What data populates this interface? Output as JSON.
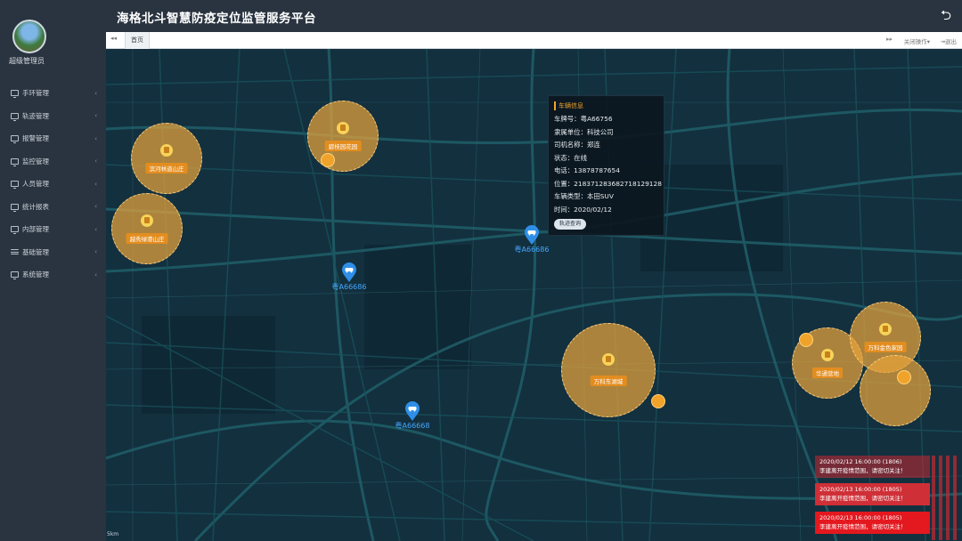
{
  "app": {
    "title": "海格北斗智慧防疫定位监管服务平台"
  },
  "user": {
    "name": "超级管理员"
  },
  "sidebar": {
    "items": [
      {
        "label": "手环管理",
        "icon": "monitor-icon"
      },
      {
        "label": "轨迹管理",
        "icon": "monitor-icon"
      },
      {
        "label": "报警管理",
        "icon": "monitor-icon"
      },
      {
        "label": "监控管理",
        "icon": "monitor-icon"
      },
      {
        "label": "人员管理",
        "icon": "monitor-icon"
      },
      {
        "label": "统计报表",
        "icon": "monitor-icon"
      },
      {
        "label": "内部管理",
        "icon": "monitor-icon"
      },
      {
        "label": "基础管理",
        "icon": "list-icon"
      },
      {
        "label": "系统管理",
        "icon": "monitor-icon"
      }
    ]
  },
  "tabs": {
    "prev": "◂◂",
    "home": "首页",
    "next": "▸▸",
    "close_ops": "关闭操作▾",
    "logout": "⇥退出"
  },
  "map": {
    "zones": [
      {
        "label": "滨河林道山庄"
      },
      {
        "label": "碧桂园花园"
      },
      {
        "label": "越秀绿港山庄"
      },
      {
        "label": "万科东湖城"
      },
      {
        "label": "华通营地"
      },
      {
        "label": "万科金色家园"
      }
    ],
    "vehicles": [
      {
        "plate": "粤A66686"
      },
      {
        "plate": "粤A66686"
      },
      {
        "plate": "粤A66668"
      }
    ],
    "scale": "5km"
  },
  "vehicle_info": {
    "title": "车辆信息",
    "rows": [
      "车牌号：粤A66756",
      "隶属单位：科技公司",
      "司机名称：郑连",
      "状态：在线",
      "电话：13878787654",
      "位置：21837128368271​8129128",
      "车辆类型：本田SUV",
      "时间：2020/02/12"
    ],
    "button": "轨迹查询"
  },
  "alerts": [
    {
      "line1": "2020/02/12  16:00:00  (1806)",
      "line2": "李建离开疫情范围，请密切关注！"
    },
    {
      "line1": "2020/02/13  16:00:00  (1805)",
      "line2": "李建离开疫情范围，请密切关注！"
    },
    {
      "line1": "2020/02/13  16:00:00  (1805)",
      "line2": "李建离开疫情范围，请密切关注！"
    }
  ]
}
